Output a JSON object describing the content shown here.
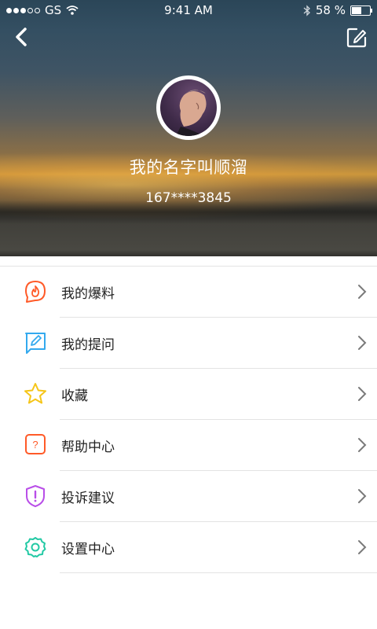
{
  "status_bar": {
    "carrier": "GS",
    "time": "9:41 AM",
    "battery_pct": "58 %",
    "battery_level": 0.58
  },
  "header": {
    "back_icon": "chevron-left-icon",
    "edit_icon": "edit-icon",
    "username": "我的名字叫顺溜",
    "phone": "167****3845"
  },
  "menu": {
    "items": [
      {
        "label": "我的爆料",
        "icon": "flame-bubble-icon",
        "color": "#ff5a28"
      },
      {
        "label": "我的提问",
        "icon": "pencil-bubble-icon",
        "color": "#33a9ee"
      },
      {
        "label": "收藏",
        "icon": "star-icon",
        "color": "#f5c518"
      },
      {
        "label": "帮助中心",
        "icon": "question-bubble-icon",
        "color": "#ff5a28"
      },
      {
        "label": "投诉建议",
        "icon": "shield-alert-icon",
        "color": "#b94ee8"
      },
      {
        "label": "设置中心",
        "icon": "gear-icon",
        "color": "#22c9a4"
      }
    ]
  }
}
